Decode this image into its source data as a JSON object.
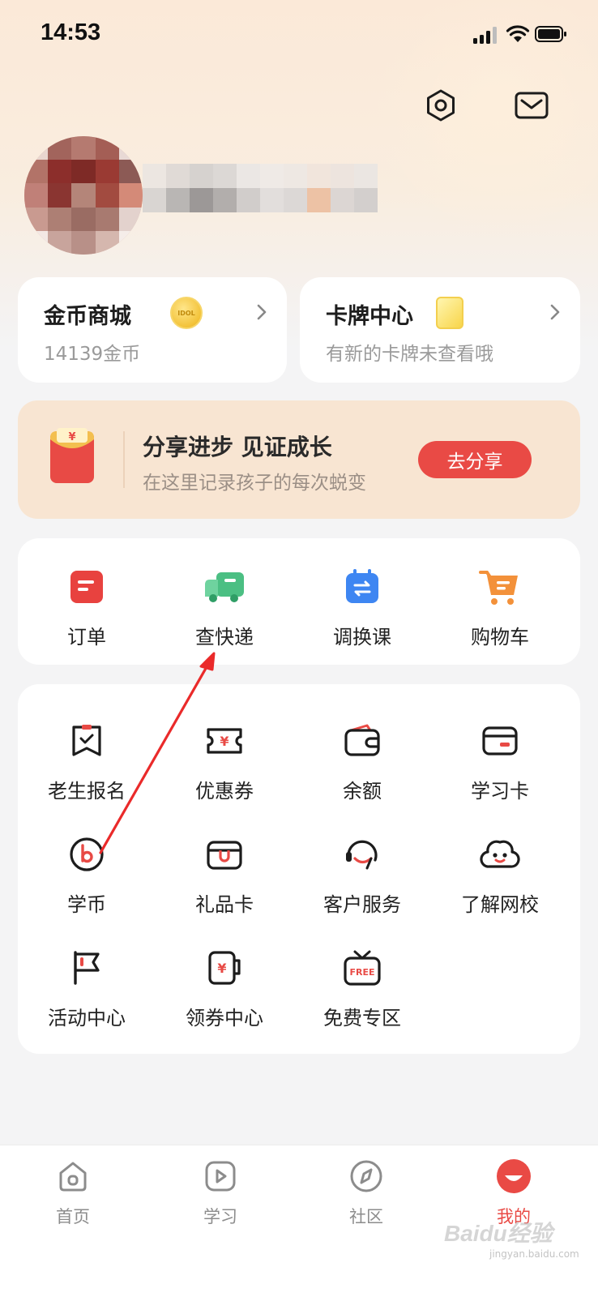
{
  "status_bar": {
    "time": "14:53"
  },
  "top_actions": {
    "settings": "settings-icon",
    "mail": "mail-icon"
  },
  "cards": [
    {
      "title": "金币商城",
      "subtitle": "14139金币",
      "icon": "gold-coin-icon",
      "badge_text": "IDOL"
    },
    {
      "title": "卡牌中心",
      "subtitle": "有新的卡牌未查看哦",
      "icon": "card-icon"
    }
  ],
  "share_banner": {
    "title": "分享进步 见证成长",
    "subtitle": "在这里记录孩子的每次蜕变",
    "button": "去分享",
    "icon": "red-packet-icon"
  },
  "quick_actions": [
    {
      "label": "订单",
      "icon": "order-icon",
      "color": "#e8423f"
    },
    {
      "label": "查快递",
      "icon": "delivery-truck-icon",
      "color": "#4bbf83"
    },
    {
      "label": "调换课",
      "icon": "calendar-swap-icon",
      "color": "#3e86f2"
    },
    {
      "label": "购物车",
      "icon": "shopping-cart-icon",
      "color": "#f3913a"
    }
  ],
  "services": [
    {
      "label": "老生报名",
      "icon": "enroll-icon"
    },
    {
      "label": "优惠券",
      "icon": "coupon-icon"
    },
    {
      "label": "余额",
      "icon": "wallet-icon"
    },
    {
      "label": "学习卡",
      "icon": "study-card-icon"
    },
    {
      "label": "学币",
      "icon": "study-coin-icon"
    },
    {
      "label": "礼品卡",
      "icon": "gift-card-icon"
    },
    {
      "label": "客户服务",
      "icon": "customer-service-icon"
    },
    {
      "label": "了解网校",
      "icon": "about-school-icon"
    },
    {
      "label": "活动中心",
      "icon": "activity-flag-icon"
    },
    {
      "label": "领券中心",
      "icon": "coupon-center-icon"
    },
    {
      "label": "免费专区",
      "icon": "free-tv-icon",
      "badge_text": "FREE"
    }
  ],
  "bottom_nav": [
    {
      "label": "首页",
      "icon": "home-icon",
      "active": false
    },
    {
      "label": "学习",
      "icon": "play-icon",
      "active": false
    },
    {
      "label": "社区",
      "icon": "compass-icon",
      "active": false
    },
    {
      "label": "我的",
      "icon": "profile-icon",
      "active": true
    }
  ],
  "watermark": {
    "text": "Baidu经验",
    "sub": "jingyan.baidu.com"
  },
  "colors": {
    "accent": "#e94a45",
    "banner_bg": "#f8e5d2",
    "page_bg": "#f4f4f5"
  }
}
